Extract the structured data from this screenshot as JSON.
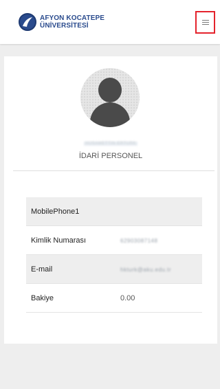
{
  "header": {
    "logo_line1": "AFYON KOCATEPE",
    "logo_line2": "ÜNİVERSİTESİ",
    "menu_icon": "hamburger-icon",
    "colors": {
      "brand": "#2a4b8d",
      "highlight": "#e4222c"
    }
  },
  "profile": {
    "avatar_icon": "user-silhouette-icon",
    "name_redacted": "HÜSAMETTİN ERTÜRK",
    "role": "İDARİ PERSONEL"
  },
  "info": {
    "rows": [
      {
        "label": "MobilePhone1",
        "value": ""
      },
      {
        "label": "Kimlik Numarası",
        "value": "62903087148"
      },
      {
        "label": "E-mail",
        "value": "hkturk@aku.edu.tr"
      },
      {
        "label": "Bakiye",
        "value": "0.00"
      }
    ]
  }
}
